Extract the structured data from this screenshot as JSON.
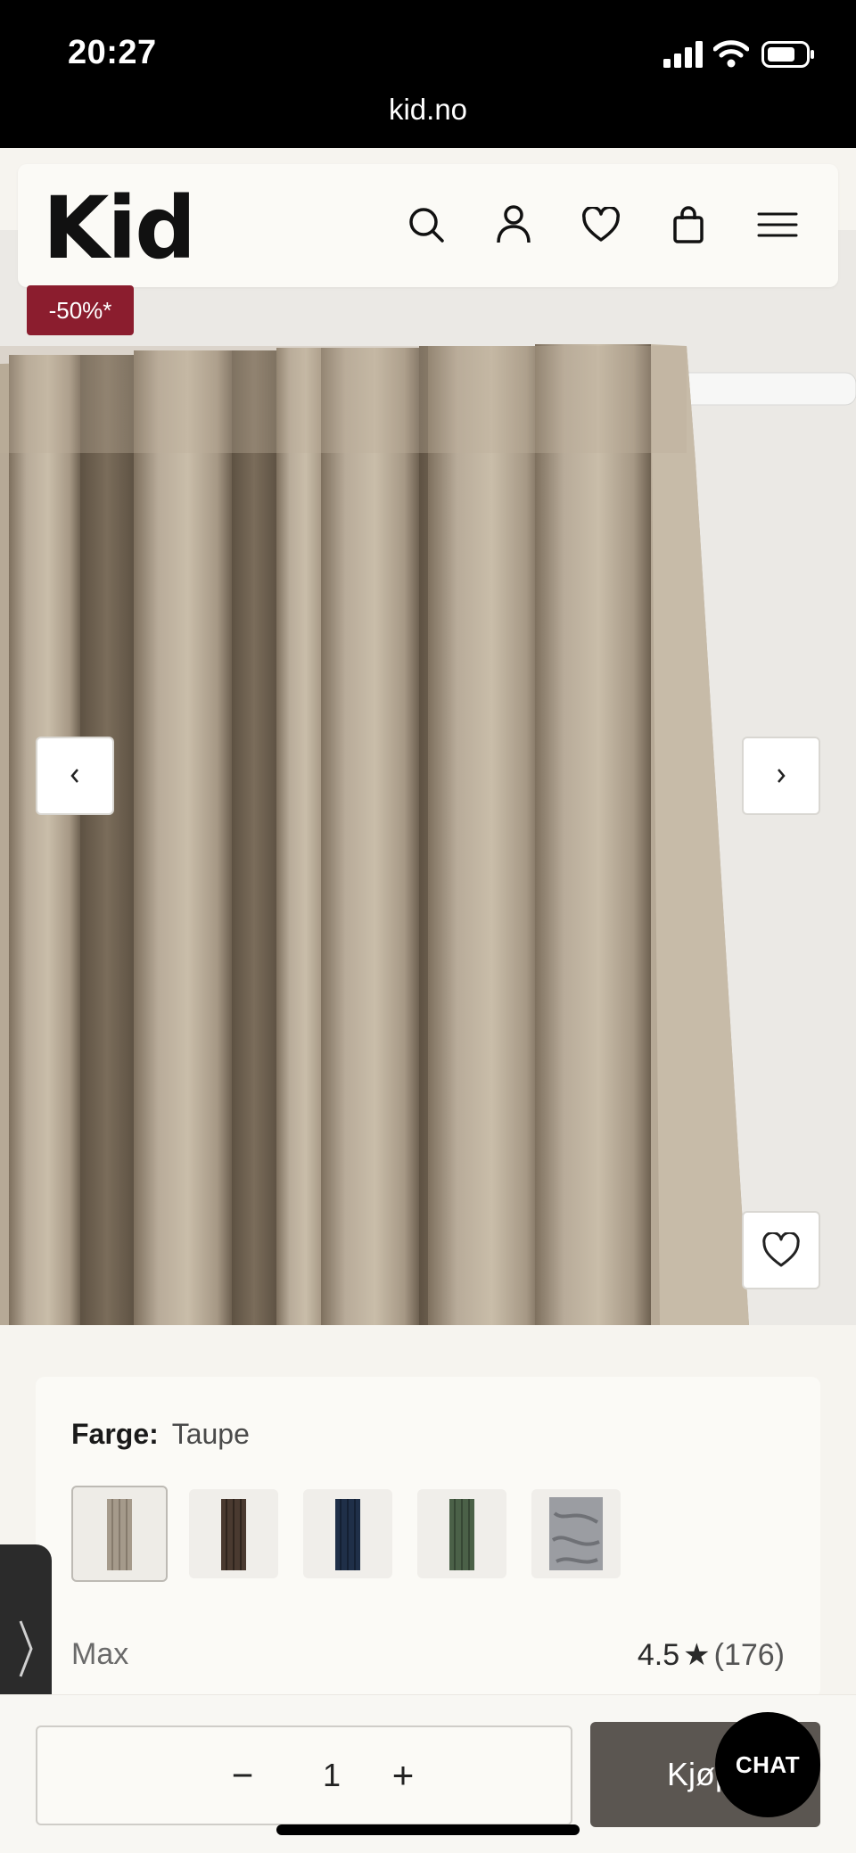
{
  "status_bar": {
    "time": "20:27",
    "url": "kid.no"
  },
  "header": {
    "logo": "Kid",
    "icons": [
      "search-icon",
      "account-icon",
      "wishlist-heart-icon",
      "cart-bag-icon",
      "menu-icon"
    ]
  },
  "product": {
    "discount_badge": "-50%*",
    "color_label": "Farge:",
    "color_value": "Taupe",
    "swatches": [
      {
        "name": "Taupe",
        "hex": "#a59a8b",
        "selected": true
      },
      {
        "name": "Brown",
        "hex": "#4a3a30",
        "selected": false
      },
      {
        "name": "Navy",
        "hex": "#1f2f48",
        "selected": false
      },
      {
        "name": "Green",
        "hex": "#4b6148",
        "selected": false
      },
      {
        "name": "Grey fabric",
        "hex": "#8d8f94",
        "selected": false
      }
    ],
    "brand": "Max",
    "rating": "4.5",
    "rating_star": "★",
    "review_count": "(176)"
  },
  "purchase": {
    "minus": "−",
    "quantity": "1",
    "plus": "+",
    "buy_label": "Kjøp",
    "chat_label": "CHAT"
  },
  "colors": {
    "badge": "#8b1d2e",
    "buy_button": "#5b5651",
    "curtain": "#b3a694"
  }
}
